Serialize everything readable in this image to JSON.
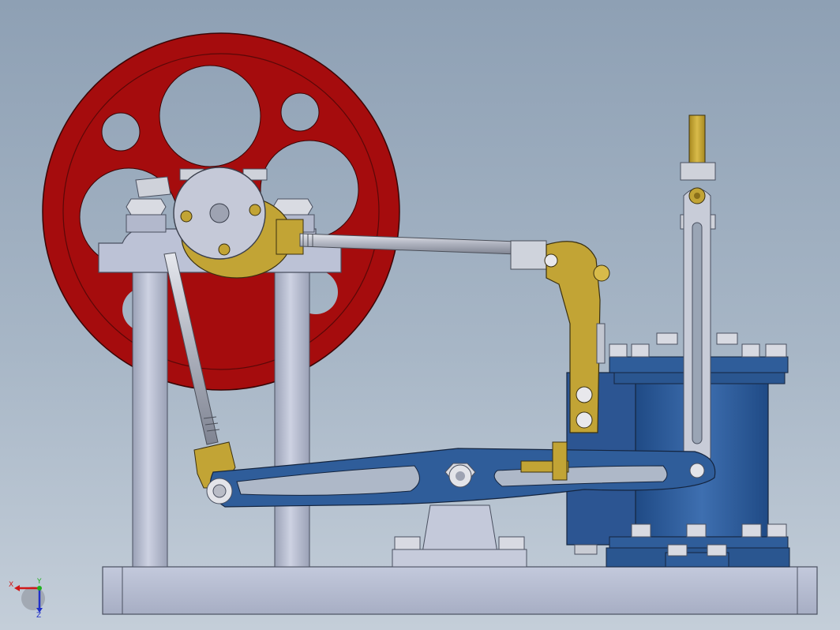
{
  "viewport": {
    "background_top": "#8ea0b4",
    "background_bottom": "#c4ced9"
  },
  "model": {
    "flywheel_color": "#a50c0d",
    "frame_color": "#b9c0d3",
    "brass_color": "#c2a435",
    "blue_color": "#2f5d9a",
    "steel_color": "#c9ccd4"
  },
  "triad": {
    "x_label": "X",
    "y_label": "Y",
    "z_label": "Z",
    "x_color": "#d01818",
    "y_color": "#20b020",
    "z_color": "#2030c8"
  }
}
